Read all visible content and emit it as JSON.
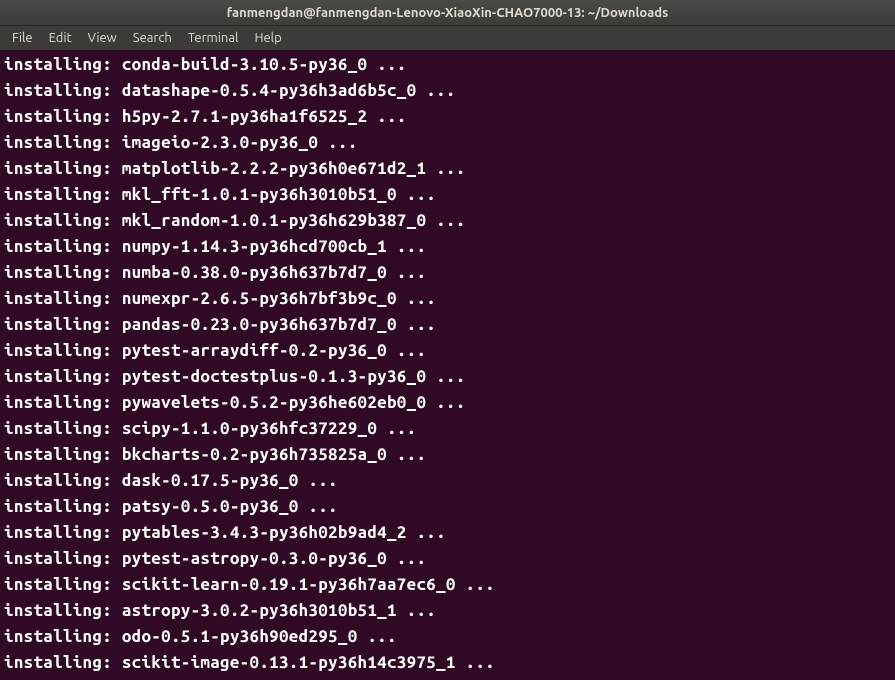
{
  "window": {
    "title": "fanmengdan@fanmengdan-Lenovo-XiaoXin-CHAO7000-13: ~/Downloads"
  },
  "menubar": {
    "items": [
      {
        "label": "File"
      },
      {
        "label": "Edit"
      },
      {
        "label": "View"
      },
      {
        "label": "Search"
      },
      {
        "label": "Terminal"
      },
      {
        "label": "Help"
      }
    ]
  },
  "terminal": {
    "lines": [
      "installing: conda-build-3.10.5-py36_0 ...",
      "installing: datashape-0.5.4-py36h3ad6b5c_0 ...",
      "installing: h5py-2.7.1-py36ha1f6525_2 ...",
      "installing: imageio-2.3.0-py36_0 ...",
      "installing: matplotlib-2.2.2-py36h0e671d2_1 ...",
      "installing: mkl_fft-1.0.1-py36h3010b51_0 ...",
      "installing: mkl_random-1.0.1-py36h629b387_0 ...",
      "installing: numpy-1.14.3-py36hcd700cb_1 ...",
      "installing: numba-0.38.0-py36h637b7d7_0 ...",
      "installing: numexpr-2.6.5-py36h7bf3b9c_0 ...",
      "installing: pandas-0.23.0-py36h637b7d7_0 ...",
      "installing: pytest-arraydiff-0.2-py36_0 ...",
      "installing: pytest-doctestplus-0.1.3-py36_0 ...",
      "installing: pywavelets-0.5.2-py36he602eb0_0 ...",
      "installing: scipy-1.1.0-py36hfc37229_0 ...",
      "installing: bkcharts-0.2-py36h735825a_0 ...",
      "installing: dask-0.17.5-py36_0 ...",
      "installing: patsy-0.5.0-py36_0 ...",
      "installing: pytables-3.4.3-py36h02b9ad4_2 ...",
      "installing: pytest-astropy-0.3.0-py36_0 ...",
      "installing: scikit-learn-0.19.1-py36h7aa7ec6_0 ...",
      "installing: astropy-3.0.2-py36h3010b51_1 ...",
      "installing: odo-0.5.1-py36h90ed295_0 ...",
      "installing: scikit-image-0.13.1-py36h14c3975_1 ..."
    ]
  }
}
